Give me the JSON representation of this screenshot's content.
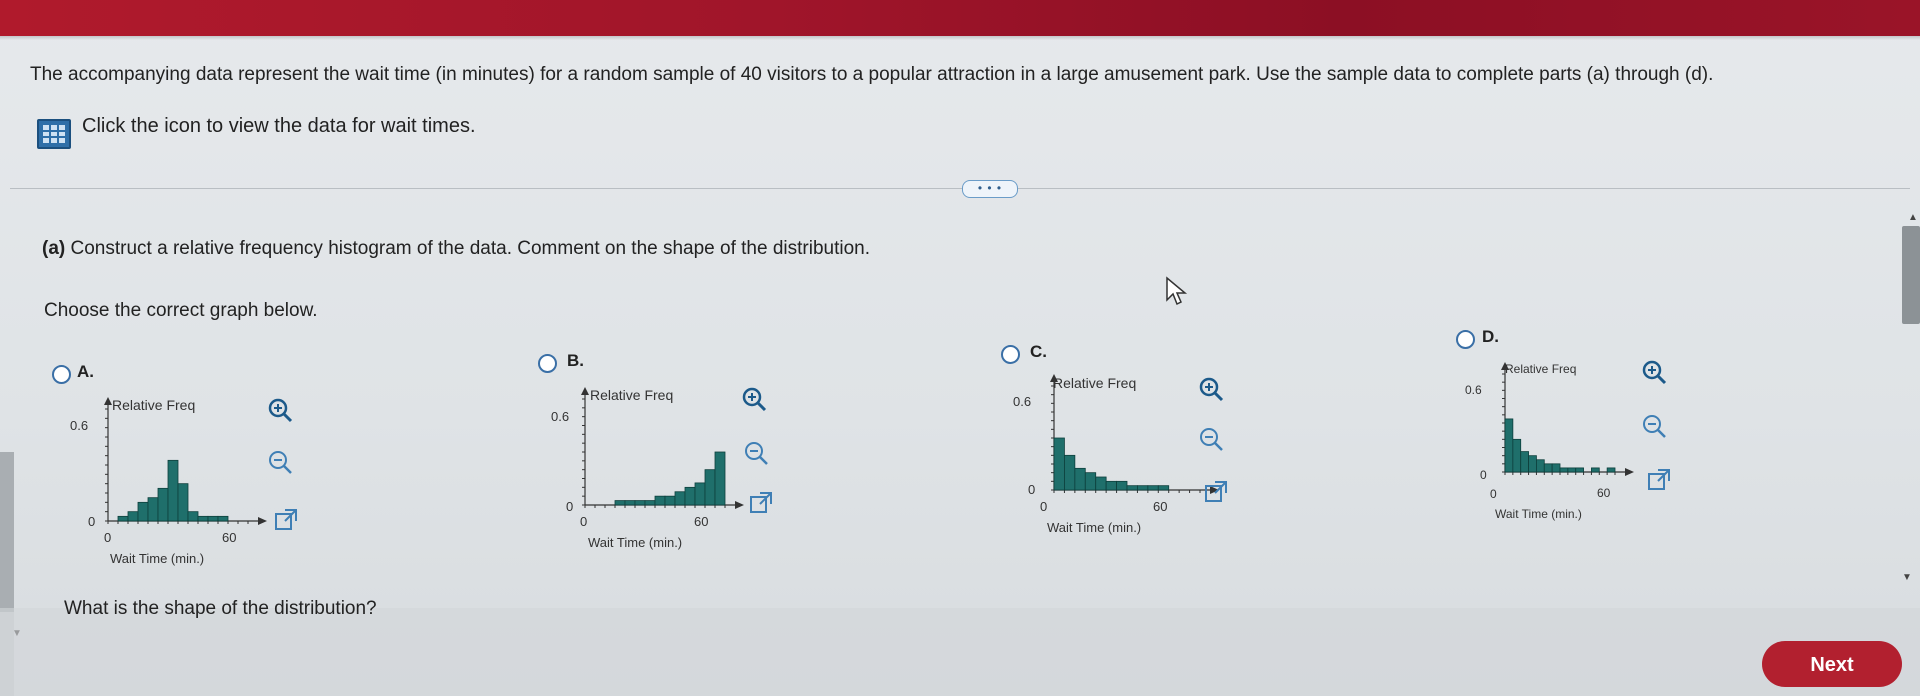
{
  "question_text": "The accompanying data represent the wait time (in minutes) for a random sample of 40 visitors to a popular attraction in a large amusement park. Use the sample data to complete parts (a) through (d).",
  "data_link_text": "Click the icon to view the data for wait times.",
  "more_button": "• • •",
  "part_a_label": "(a)",
  "part_a_text": "Construct a relative frequency histogram of the data. Comment on the shape of the distribution.",
  "choose_text": "Choose the correct graph below.",
  "options": [
    {
      "letter": "A.",
      "ylabel": "Relative Freq",
      "xlabel": "Wait Time (min.)",
      "ytop": "0.6",
      "ybottom": "0",
      "x0": "0",
      "x60": "60"
    },
    {
      "letter": "B.",
      "ylabel": "Relative Freq",
      "xlabel": "Wait Time (min.)",
      "ytop": "0.6",
      "ybottom": "0",
      "x0": "0",
      "x60": "60"
    },
    {
      "letter": "C.",
      "ylabel": "Relative Freq",
      "xlabel": "Wait Time (min.)",
      "ytop": "0.6",
      "ybottom": "0",
      "x0": "0",
      "x60": "60"
    },
    {
      "letter": "D.",
      "ylabel": "Relative Freq",
      "xlabel": "Wait Time (min.)",
      "ytop": "0.6",
      "ybottom": "0",
      "x0": "0",
      "x60": "60"
    }
  ],
  "chart_data": [
    {
      "type": "bar",
      "x_range": [
        0,
        60
      ],
      "ylim": [
        0,
        0.6
      ],
      "values": [
        0.0,
        0.025,
        0.05,
        0.1,
        0.125,
        0.175,
        0.325,
        0.2,
        0.05,
        0.025,
        0.025,
        0.025,
        0.0,
        0.0
      ]
    },
    {
      "type": "bar",
      "x_range": [
        0,
        60
      ],
      "ylim": [
        0,
        0.6
      ],
      "values": [
        0.0,
        0.0,
        0.0,
        0.025,
        0.025,
        0.025,
        0.025,
        0.05,
        0.05,
        0.075,
        0.1,
        0.125,
        0.2,
        0.3
      ]
    },
    {
      "type": "bar",
      "x_range": [
        0,
        60
      ],
      "ylim": [
        0,
        0.6
      ],
      "values": [
        0.3,
        0.2,
        0.125,
        0.1,
        0.075,
        0.05,
        0.05,
        0.025,
        0.025,
        0.025,
        0.025,
        0.0,
        0.0,
        0.0
      ]
    },
    {
      "type": "bar",
      "x_range": [
        0,
        60
      ],
      "ylim": [
        0,
        0.6
      ],
      "values": [
        0.325,
        0.2,
        0.125,
        0.1,
        0.075,
        0.05,
        0.05,
        0.025,
        0.025,
        0.025,
        0.0,
        0.025,
        0.0,
        0.025
      ]
    }
  ],
  "bar_color": "#1f6f6b",
  "shape_question": "What is the shape of the distribution?",
  "next_label": "Next"
}
